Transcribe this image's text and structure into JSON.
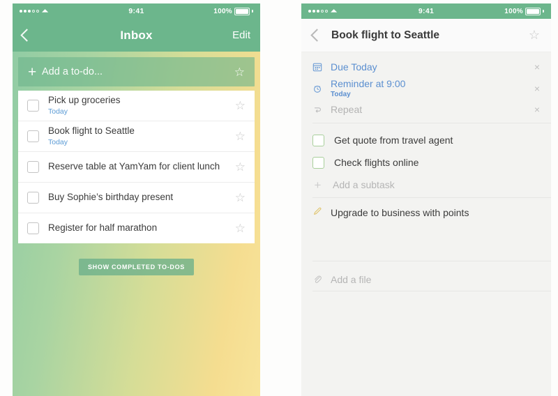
{
  "colors": {
    "green_header": "#6cb68c",
    "accent_blue": "#5b8fd0",
    "today_blue": "#5b9bd5",
    "subtask_green": "#a8cf9b",
    "pencil_yellow": "#e4c66a",
    "gradient_start": "#8ecba4",
    "gradient_end": "#f8e49b",
    "detail_bg": "#f3f3f1"
  },
  "left_phone": {
    "status_bar": {
      "signal_filled": 3,
      "signal_empty": 2,
      "wifi_icon": "wifi-icon",
      "time": "9:41",
      "battery_percent": "100%",
      "battery_icon": "battery-full-icon"
    },
    "nav": {
      "back_icon": "chevron-left-icon",
      "title": "Inbox",
      "edit_label": "Edit"
    },
    "add_todo": {
      "plus_icon": "plus-icon",
      "placeholder": "Add a to-do...",
      "value": "",
      "star_icon": "star-outline-icon"
    },
    "todos": [
      {
        "title": "Pick up groceries",
        "sub": "Today",
        "checked": false,
        "starred": false
      },
      {
        "title": "Book flight to Seattle",
        "sub": "Today",
        "checked": false,
        "starred": false
      },
      {
        "title": "Reserve table at YamYam for client lunch",
        "sub": "",
        "checked": false,
        "starred": false
      },
      {
        "title": "Buy Sophie’s birthday present",
        "sub": "",
        "checked": false,
        "starred": false
      },
      {
        "title": "Register for half marathon",
        "sub": "",
        "checked": false,
        "starred": false
      }
    ],
    "show_completed_label": "SHOW COMPLETED TO-DOS"
  },
  "right_phone": {
    "status_bar": {
      "signal_filled": 3,
      "signal_empty": 2,
      "wifi_icon": "wifi-icon",
      "time": "9:41",
      "battery_percent": "100%",
      "battery_icon": "battery-full-icon"
    },
    "nav": {
      "back_icon": "chevron-left-icon",
      "title": "Book flight to Seattle",
      "star_icon": "star-outline-icon"
    },
    "meta_rows": [
      {
        "icon": "calendar-icon",
        "title": "Due Today",
        "sub": "",
        "muted": false,
        "clear_icon": "×"
      },
      {
        "icon": "alarm-clock-icon",
        "title": "Reminder at 9:00",
        "sub": "Today",
        "muted": false,
        "clear_icon": "×"
      },
      {
        "icon": "repeat-icon",
        "title": "Repeat",
        "sub": "",
        "muted": true,
        "clear_icon": "×"
      }
    ],
    "subtasks": [
      {
        "label": "Get quote from travel agent",
        "checked": false
      },
      {
        "label": "Check flights online",
        "checked": false
      }
    ],
    "add_subtask": {
      "plus_icon": "plus-icon",
      "placeholder": "Add a subtask"
    },
    "note": {
      "icon": "pencil-icon",
      "text": "Upgrade to business with points"
    },
    "add_file": {
      "icon": "paperclip-icon",
      "placeholder": "Add a file"
    }
  }
}
